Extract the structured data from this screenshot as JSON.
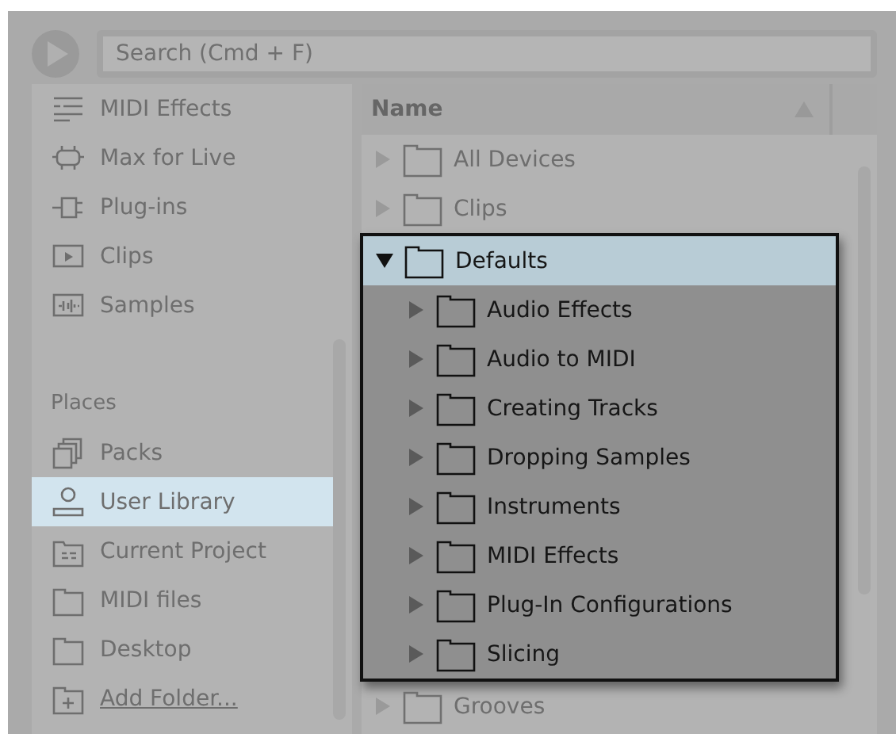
{
  "search": {
    "placeholder": "Search (Cmd + F)"
  },
  "sidebar": {
    "categories": [
      {
        "label": "MIDI Effects",
        "kind": "midi"
      },
      {
        "label": "Max for Live",
        "kind": "max"
      },
      {
        "label": "Plug-ins",
        "kind": "plugin"
      },
      {
        "label": "Clips",
        "kind": "clip"
      },
      {
        "label": "Samples",
        "kind": "sample"
      }
    ],
    "places_heading": "Places",
    "places": [
      {
        "label": "Packs",
        "kind": "packs",
        "selected": false
      },
      {
        "label": "User Library",
        "kind": "user",
        "selected": true
      },
      {
        "label": "Current Project",
        "kind": "project",
        "selected": false
      },
      {
        "label": "MIDI files",
        "kind": "folder",
        "selected": false
      },
      {
        "label": "Desktop",
        "kind": "folder",
        "selected": false
      },
      {
        "label": "Add Folder...",
        "kind": "add",
        "selected": false
      }
    ]
  },
  "browser": {
    "column": "Name",
    "items": [
      {
        "label": "All Devices",
        "expanded": false
      },
      {
        "label": "Clips",
        "expanded": false
      },
      {
        "label": "Defaults",
        "expanded": true,
        "children": [
          {
            "label": "Audio Effects",
            "expanded": false
          },
          {
            "label": "Audio to MIDI",
            "expanded": false
          },
          {
            "label": "Creating Tracks",
            "expanded": false
          },
          {
            "label": "Dropping Samples",
            "expanded": false
          },
          {
            "label": "Instruments",
            "expanded": false
          },
          {
            "label": "MIDI Effects",
            "expanded": false
          },
          {
            "label": "Plug-In Configurations",
            "expanded": false
          },
          {
            "label": "Slicing",
            "expanded": false
          }
        ]
      },
      {
        "label": "Grooves",
        "expanded": false
      }
    ]
  }
}
